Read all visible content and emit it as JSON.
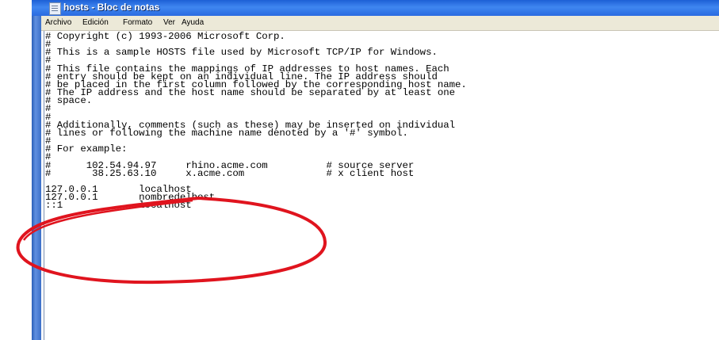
{
  "window": {
    "title": "hosts - Bloc de notas"
  },
  "menu": {
    "items": [
      "Archivo",
      "Edición",
      "Formato",
      "Ver",
      "Ayuda"
    ]
  },
  "editor": {
    "content": "# Copyright (c) 1993-2006 Microsoft Corp.\n#\n# This is a sample HOSTS file used by Microsoft TCP/IP for Windows.\n#\n# This file contains the mappings of IP addresses to host names. Each\n# entry should be kept on an individual line. The IP address should\n# be placed in the first column followed by the corresponding host name.\n# The IP address and the host name should be separated by at least one\n# space.\n#\n#\n# Additionally, comments (such as these) may be inserted on individual\n# lines or following the machine name denoted by a '#' symbol.\n#\n# For example:\n#\n#      102.54.94.97     rhino.acme.com          # source server\n#       38.25.63.10     x.acme.com              # x client host\n\n127.0.0.1       localhost\n127.0.0.1       nombredelhost\n::1             localhost"
  },
  "colors": {
    "titlebar": "#2a6be0",
    "menubar": "#ece9d8",
    "annotation": "#e0141e"
  },
  "icons": {
    "window": "notepad-icon"
  }
}
